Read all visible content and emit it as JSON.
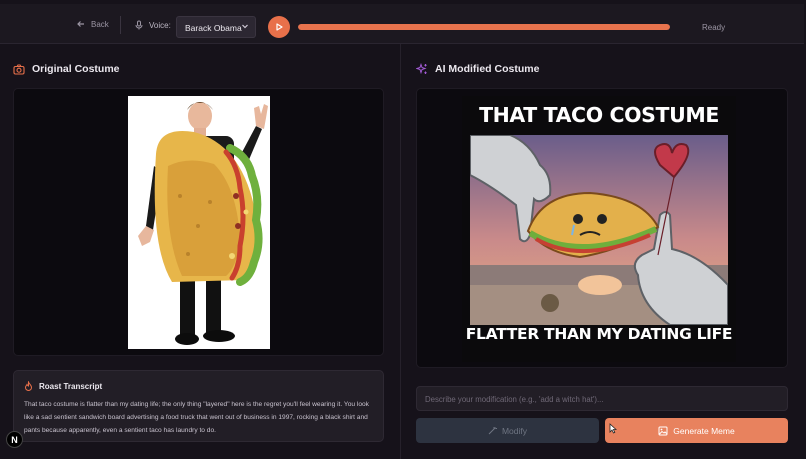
{
  "header": {
    "back_label": "Back",
    "voice_label": "Voice:",
    "voice_selected": "Barack Obama",
    "progress_percent": 100,
    "status": "Ready",
    "accent_color": "#e8704a"
  },
  "left": {
    "title": "Original Costume",
    "title_icon": "camera-icon",
    "image_alt": "Person wearing a taco costume",
    "transcript": {
      "title": "Roast Transcript",
      "icon": "flame-icon",
      "text": "That taco costume is flatter than my dating life; the only thing \"layered\" here is the regret you'll feel wearing it. You look like a sad sentient sandwich board advertising a food truck that went out of business in 1997, rocking a black shirt and pants because apparently, even a sentient taco has laundry to do."
    }
  },
  "right": {
    "title": "AI Modified Costume",
    "title_icon": "sparkles-icon",
    "meme": {
      "top_text": "THAT TACO COSTUME",
      "bottom_text": "FLATTER THAN MY DATING LIFE"
    },
    "input_placeholder": "Describe your modification (e.g., 'add a witch hat')...",
    "modify_label": "Modify",
    "generate_label": "Generate Meme"
  },
  "badge": "N"
}
